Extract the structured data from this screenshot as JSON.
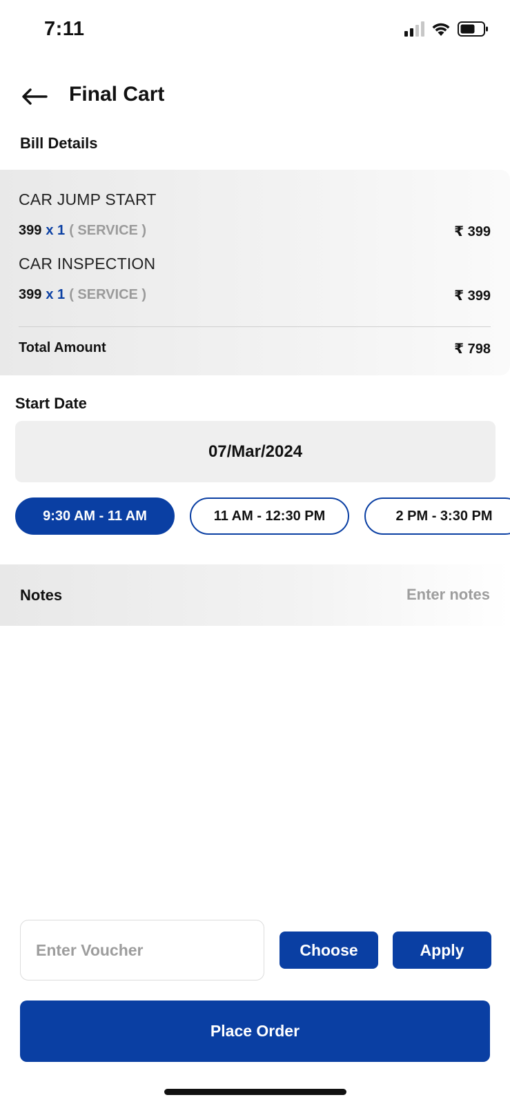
{
  "status_bar": {
    "time": "7:11",
    "icons": [
      "signal-icon",
      "wifi-icon",
      "battery-icon"
    ]
  },
  "header": {
    "title": "Final Cart",
    "back_icon": "arrow-left-icon"
  },
  "bill": {
    "section_label": "Bill Details",
    "items": [
      {
        "name": "CAR JUMP START",
        "unit_price": "399",
        "qty": "x 1",
        "type": "( SERVICE )",
        "price": "₹ 399"
      },
      {
        "name": "CAR INSPECTION",
        "unit_price": "399",
        "qty": "x 1",
        "type": "( SERVICE )",
        "price": "₹ 399"
      }
    ],
    "total_label": "Total Amount",
    "total_value": "₹ 798"
  },
  "schedule": {
    "label": "Start Date",
    "date": "07/Mar/2024",
    "slots": [
      {
        "label": "9:30 AM - 11 AM",
        "selected": true
      },
      {
        "label": "11 AM - 12:30 PM",
        "selected": false
      },
      {
        "label": "2 PM - 3:30 PM",
        "selected": false
      }
    ]
  },
  "notes": {
    "label": "Notes",
    "placeholder": "Enter notes"
  },
  "voucher": {
    "placeholder": "Enter Voucher",
    "choose_label": "Choose",
    "apply_label": "Apply"
  },
  "footer": {
    "place_order_label": "Place Order"
  },
  "colors": {
    "primary": "#0a3fa3",
    "muted": "#9d9d9d",
    "card_bg": "#efefef"
  }
}
